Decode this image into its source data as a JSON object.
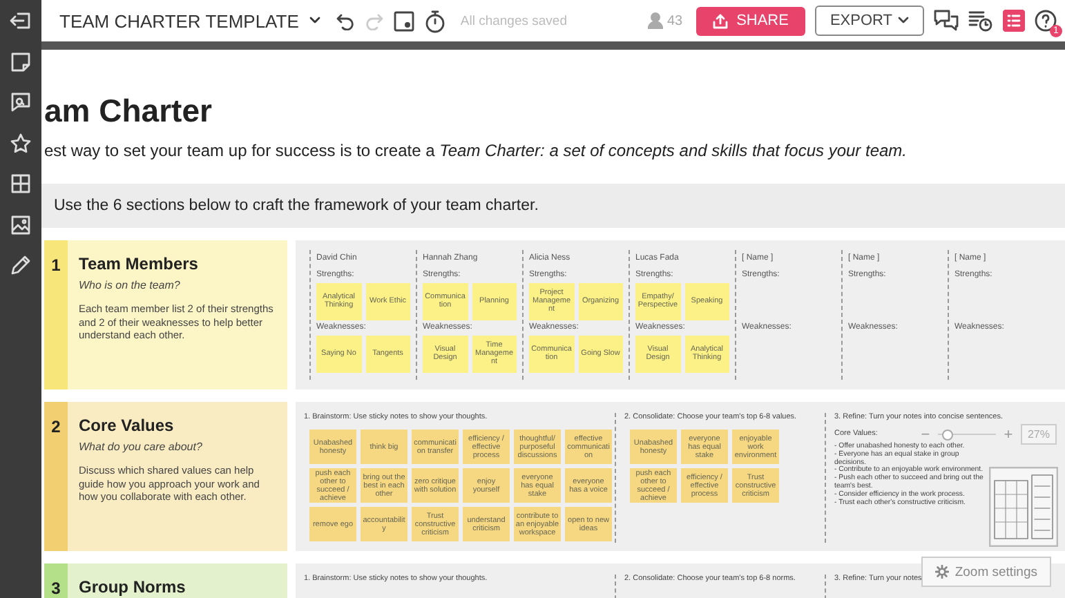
{
  "toolbar": {
    "title": "TEAM CHARTER TEMPLATE",
    "redo_disabled": true,
    "saved_status": "All changes saved",
    "user_count": "43",
    "share": "SHARE",
    "export": "EXPORT",
    "help_badge": "1"
  },
  "heading": "am Charter",
  "intro": "est way to set your team up for success is to create a *Team Charter: a set of concepts and skills that focus your team.*",
  "instruction": "Use the 6 sections below to craft the framework of your team charter.",
  "sections": [
    {
      "kind": "members",
      "number": "1",
      "title": "Team Members",
      "question": "Who is on the team?",
      "description": "Each team member list 2 of their strengths and 2 of their weaknesses to help better understand each other.",
      "color": "#f7e77a",
      "members": [
        {
          "name": "David Chin",
          "strengths_label": "Strengths:",
          "strengths": [
            "Analytical Thinking",
            "Work Ethic"
          ],
          "weaknesses_label": "Weaknesses:",
          "weaknesses": [
            "Saying No",
            "Tangents"
          ]
        },
        {
          "name": "Hannah Zhang",
          "strengths_label": "Strengths:",
          "strengths": [
            "Communication",
            "Planning"
          ],
          "weaknesses_label": "Weaknesses:",
          "weaknesses": [
            "Visual Design",
            "Time Management"
          ]
        },
        {
          "name": "Alicia Ness",
          "strengths_label": "Strengths:",
          "strengths": [
            "Project Management",
            "Organizing"
          ],
          "weaknesses_label": "Weaknesses:",
          "weaknesses": [
            "Communication",
            "Going Slow"
          ]
        },
        {
          "name": "Lucas Fada",
          "strengths_label": "Strengths:",
          "strengths": [
            "Empathy/ Perspective",
            "Speaking"
          ],
          "weaknesses_label": "Weaknesses:",
          "weaknesses": [
            "Visual Design",
            "Analytical Thinking"
          ]
        },
        {
          "name": "[ Name ]",
          "strengths_label": "Strengths:",
          "weaknesses_label": "Weaknesses:"
        },
        {
          "name": "[ Name ]",
          "strengths_label": "Strengths:",
          "weaknesses_label": "Weaknesses:"
        },
        {
          "name": "[ Name ]",
          "strengths_label": "Strengths:",
          "weaknesses_label": "Weaknesses:"
        }
      ]
    },
    {
      "kind": "steps",
      "number": "2",
      "title": "Core Values",
      "question": "What do you care about?",
      "description": "Discuss which shared values can help guide how you approach your work and how you collaborate with each other.",
      "color": "#f2cf70",
      "brainstorm": {
        "label": "1. Brainstorm: Use sticky notes to show your thoughts.",
        "notes": [
          "Unabashed honesty",
          "think big",
          "communication transfer",
          "efficiency / effective process",
          "thoughtful/ purposeful discussions",
          "effective communication",
          "push each other to succeed / achieve",
          "bring out the best in each other",
          "zero critique with solution",
          "enjoy yourself",
          "everyone has equal stake",
          "everyone has a voice",
          "remove ego",
          "accountability",
          "Trust constructive criticism",
          "understand criticism",
          "contribute to an enjoyable workspace",
          "open to new ideas"
        ]
      },
      "consolidate": {
        "label": "2. Consolidate:  Choose your team's top 6-8 values.",
        "notes": [
          "Unabashed honesty",
          "everyone has equal stake",
          "enjoyable work environment",
          "push each other to succeed / achieve",
          "efficiency / effective process",
          "Trust constructive criticism"
        ]
      },
      "refine": {
        "label": "3. Refine: Turn your notes into concise sentences.",
        "title": "Core Values:",
        "lines": [
          "- Offer unabashed honesty to each other.",
          "- Everyone has an equal stake in group decisions.",
          "- Contribute to an enjoyable work environment.",
          "- Push each other to succeed and bring out the team's best.",
          "- Consider efficiency in the work process.",
          "- Trust each other's constructive criticism."
        ]
      }
    },
    {
      "kind": "steps",
      "number": "3",
      "title": "Group Norms",
      "color": "#b5e08a",
      "brainstorm": {
        "label": "1. Brainstorm: Use sticky notes to show your thoughts."
      },
      "consolidate": {
        "label": "2. Consolidate:  Choose your team's top 6-8 norms."
      },
      "refine": {
        "label": "3. Refine: Turn your notes"
      }
    }
  ],
  "zoom": {
    "minus": "−",
    "plus": "+",
    "level": 0.15,
    "reading": "27%",
    "settings": "Zoom settings"
  }
}
